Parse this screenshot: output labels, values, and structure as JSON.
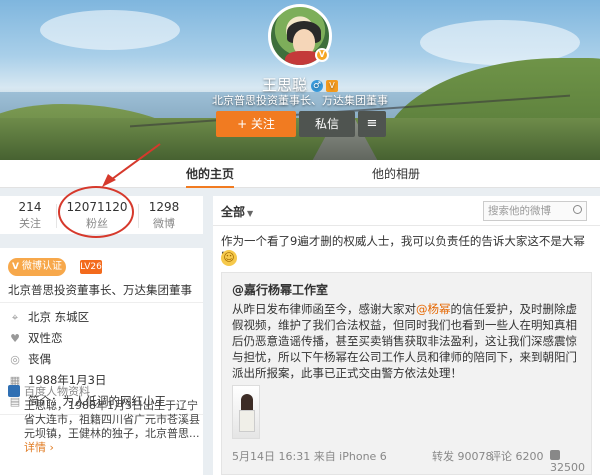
{
  "profile": {
    "name": "王思聪",
    "intro": "北京普思投资董事长、万达集团董事",
    "follow_label": "+ 关注",
    "message_label": "私信",
    "more_label": "≡"
  },
  "tabs": [
    {
      "label": "他的主页",
      "active": true
    },
    {
      "label": "他的相册",
      "active": false
    }
  ],
  "stats": [
    {
      "value": "214",
      "label": "关注"
    },
    {
      "value": "12071120",
      "label": "粉丝"
    },
    {
      "value": "1298",
      "label": "微博"
    }
  ],
  "left": {
    "verify_label": "微博认证",
    "level_label": "LV26",
    "verify_text": "北京普思投资董事长、万达集团董事",
    "details": [
      {
        "icon": "location-icon",
        "glyph": "⌖",
        "text": "北京 东城区"
      },
      {
        "icon": "heart-icon",
        "glyph": "♥",
        "text": "双性恋"
      },
      {
        "icon": "ring-icon",
        "glyph": "◎",
        "text": "丧偶"
      },
      {
        "icon": "calendar-icon",
        "glyph": "▦",
        "text": "1988年1月3日"
      },
      {
        "icon": "intro-icon",
        "glyph": "▤",
        "text": "简介：为人低调的网红小王"
      }
    ],
    "baike_title": "百度人物资料",
    "baike_text": "王思聪，1988年1月3日出生于辽宁省大连市，祖籍四川省广元市苍溪县元坝镇，王健林的独子，北京普思...",
    "baike_more": "详情 ›"
  },
  "feed": {
    "filter_label": "全部",
    "search_placeholder": "搜索他的微博",
    "post_text": "作为一个看了9遍才删的权威人士，我可以负责任的告诉大家这不是大幂幂。",
    "quote_author": "@嘉行杨幂工作室",
    "quote_part1": "从昨日发布律师函至今，感谢大家对",
    "quote_at": "@杨幂",
    "quote_part2": "的信任爱护，及时删除虚假视频，维护了我们合法权益，但同时我们也看到一些人在明知真相后仍恶意造谣传播，甚至买卖销售获取非法盈利，这让我们深感震惊与担忧，所以下午杨幂在公司工作人员和律师的陪同下，来到朝阳门派出所报案，此事已正式交由警方依法处理！",
    "quote_time": "5月14日 16:31 来自 iPhone 6",
    "forward": "转发 90078",
    "comment": "评论 6200",
    "like": "32500"
  },
  "colors": {
    "accent": "#f17b21",
    "annotation": "#d6392c",
    "link": "#e56600"
  }
}
